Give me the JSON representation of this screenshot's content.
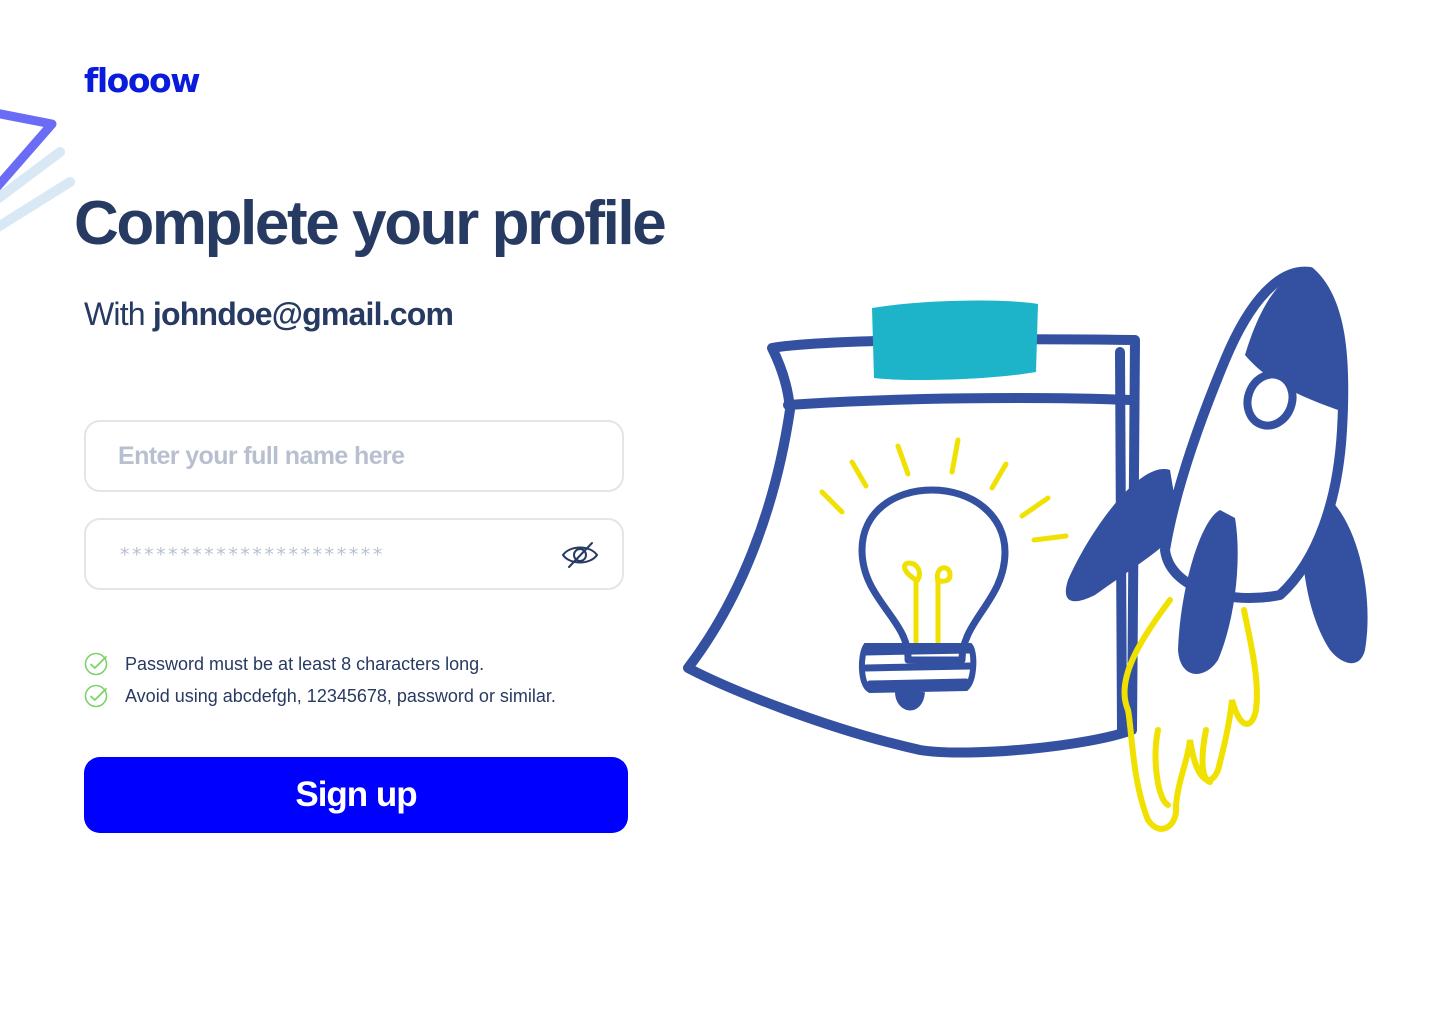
{
  "brand": {
    "logo_text": "flooow",
    "accent_color": "#0000ff"
  },
  "page": {
    "title": "Complete your profile",
    "subtitle_prefix": "With",
    "email": "johndoe@gmail.com"
  },
  "form": {
    "name_placeholder": "Enter your full name here",
    "name_value": "",
    "password_mask": "**********************",
    "toggle_icon": "eye-off-icon"
  },
  "password_rules": [
    {
      "text": "Password must be at least 8 characters long.",
      "icon": "check-circle-icon",
      "status": "met"
    },
    {
      "text": "Avoid using abcdefgh, 12345678, password or similar.",
      "icon": "check-circle-icon",
      "status": "met"
    }
  ],
  "actions": {
    "signup_label": "Sign up"
  },
  "colors": {
    "heading": "#273a62",
    "check": "#7cd36a",
    "illustration_blue": "#3451a1",
    "illustration_teal": "#1db4c9",
    "illustration_yellow": "#f0e100"
  }
}
